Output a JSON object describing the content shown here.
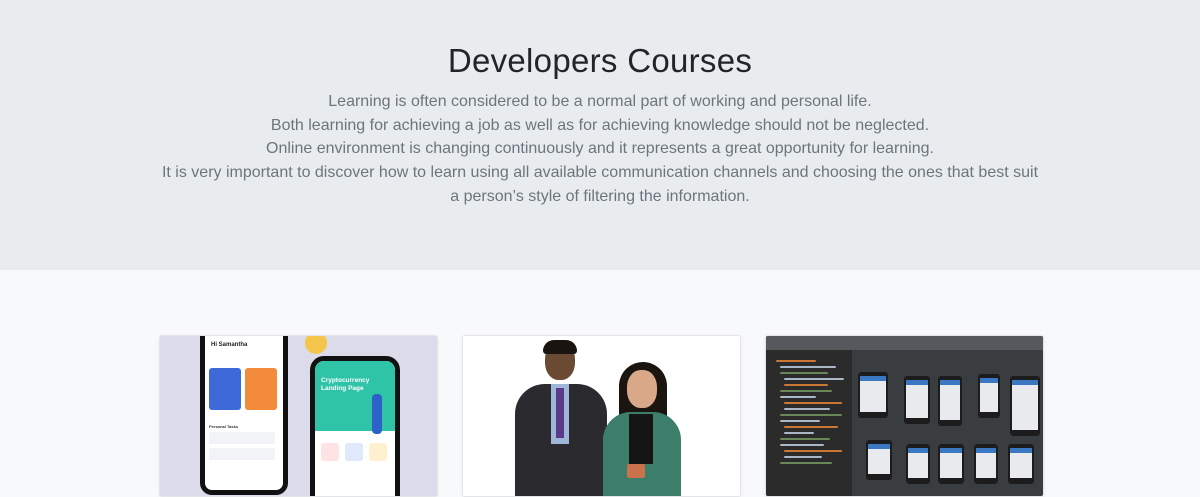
{
  "hero": {
    "title": "Developers Courses",
    "lines": [
      "Learning is often considered to be a normal part of working and personal life.",
      "Both learning for achieving a job as well as for achieving knowledge should not be neglected.",
      "Online environment is changing continuously and it represents a great opportunity for learning.",
      "It is very important to discover how to learn using all available communication channels and choosing the ones that best suit",
      "a person’s style of filtering the information."
    ]
  },
  "cards": [
    {
      "image": "mobile-app-ui-mockup",
      "greeting": "Hi Samantha",
      "section_label": "Personal Tasks",
      "promo": "Cryptocurrency Landing Page"
    },
    {
      "image": "two-instructors-video"
    },
    {
      "image": "android-studio-ide-layout-preview"
    }
  ]
}
